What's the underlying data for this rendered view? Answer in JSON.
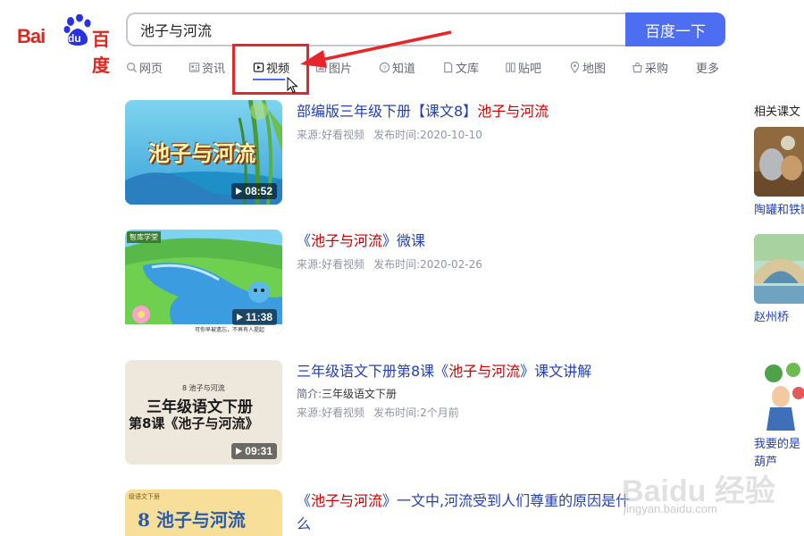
{
  "logo": {
    "left": "Bai",
    "right": "百度",
    "paw": "du"
  },
  "search": {
    "value": "池子与河流",
    "button": "百度一下"
  },
  "tabs": [
    {
      "label": "网页",
      "icon": "search-icon"
    },
    {
      "label": "资讯",
      "icon": "news-icon"
    },
    {
      "label": "视频",
      "icon": "video-icon",
      "active": true
    },
    {
      "label": "图片",
      "icon": "image-icon"
    },
    {
      "label": "知道",
      "icon": "question-icon"
    },
    {
      "label": "文库",
      "icon": "doc-icon"
    },
    {
      "label": "贴吧",
      "icon": "tieba-icon"
    },
    {
      "label": "地图",
      "icon": "map-icon"
    },
    {
      "label": "采购",
      "icon": "shop-icon"
    },
    {
      "label": "更多"
    }
  ],
  "results": [
    {
      "title_pre": "部编版三年级下册【课文8】",
      "title_em": "池子与河流",
      "title_post": "",
      "source_label": "来源:",
      "source": "好看视频",
      "date_label": "发布时间:",
      "date": "2020-10-10",
      "duration": "08:52",
      "thumb_text": "池子与河流"
    },
    {
      "title_pre": "《",
      "title_em": "池子与河流",
      "title_post": "》微课",
      "source_label": "来源:",
      "source": "好看视频",
      "date_label": "发布时间:",
      "date": "2020-02-26",
      "duration": "11:38",
      "thumb_caption": "可你早被遗忘，不再有人提起",
      "thumb_brand": "智库学堂"
    },
    {
      "title_pre": "三年级语文下册第8课《",
      "title_em": "池子与河流",
      "title_post": "》课文讲解",
      "summary_label": "简介:",
      "summary": "三年级语文下册",
      "source_label": "来源:",
      "source": "好看视频",
      "date_label": "发布时间:",
      "date": "2个月前",
      "duration": "09:31",
      "thumb_line1": "三年级语文下册",
      "thumb_line2": "第8课《池子与河流》",
      "thumb_small": "8 池子与河流"
    },
    {
      "title_pre": "《",
      "title_em": "池子与河流",
      "title_post": "》一文中,河流受到人们尊重的原因是什么",
      "thumb_text": "8 池子与河流",
      "thumb_small": "级语文下册"
    }
  ],
  "sidebar": {
    "title": "相关课文",
    "items": [
      {
        "label": "陶罐和铁罐"
      },
      {
        "label": "赵州桥"
      },
      {
        "label": "我要的是葫芦"
      }
    ]
  },
  "watermark": {
    "text": "Baidu 经验",
    "url": "jingyan.baidu.com"
  }
}
